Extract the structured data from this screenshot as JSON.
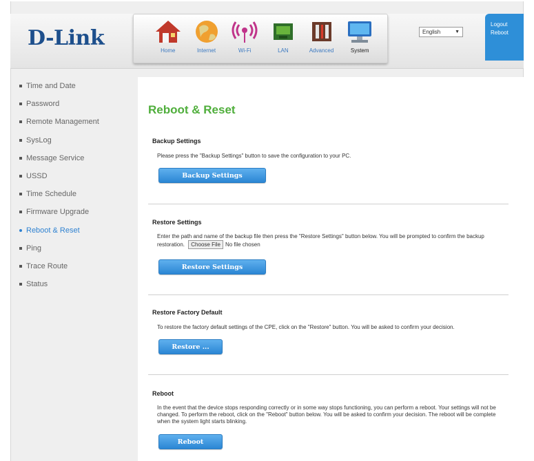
{
  "brand": {
    "logo": "D-Link"
  },
  "toolbar": {
    "items": [
      {
        "label": "Home",
        "icon": "home-icon"
      },
      {
        "label": "Internet",
        "icon": "globe-icon"
      },
      {
        "label": "Wi-Fi",
        "icon": "wifi-icon"
      },
      {
        "label": "LAN",
        "icon": "lan-icon"
      },
      {
        "label": "Advanced",
        "icon": "tools-icon"
      },
      {
        "label": "System",
        "icon": "computer-icon"
      }
    ],
    "active": "System"
  },
  "language": {
    "selected": "English"
  },
  "account": {
    "logout": "Logout",
    "reboot": "Reboot"
  },
  "sidebar": {
    "items": [
      {
        "label": "Time and Date"
      },
      {
        "label": "Password"
      },
      {
        "label": "Remote Management"
      },
      {
        "label": "SysLog"
      },
      {
        "label": "Message Service"
      },
      {
        "label": "USSD"
      },
      {
        "label": "Time Schedule"
      },
      {
        "label": "Firmware Upgrade"
      },
      {
        "label": "Reboot & Reset"
      },
      {
        "label": "Ping"
      },
      {
        "label": "Trace Route"
      },
      {
        "label": "Status"
      }
    ],
    "active_index": 8
  },
  "main": {
    "title": "Reboot & Reset",
    "backup": {
      "heading": "Backup Settings",
      "text": "Please press the \"Backup Settings\" button to save the configuration to your PC.",
      "button": "Backup Settings"
    },
    "restore": {
      "heading": "Restore Settings",
      "text": "Enter the path and name of the backup file then press the \"Restore Settings\" button below. You will be prompted to confirm the backup restoration.",
      "choose_file": "Choose File",
      "no_file": "No file chosen",
      "button": "Restore Settings"
    },
    "factory": {
      "heading": "Restore Factory Default",
      "text": "To restore the factory default settings of the CPE, click on the \"Restore\" button. You will be asked to confirm your decision.",
      "button": "Restore ..."
    },
    "reboot": {
      "heading": "Reboot",
      "text": "In the event that the device stops responding correctly or in some way stops functioning, you can perform a reboot. Your settings will not be changed. To perform the reboot, click on the \"Reboot\" button below. You will be asked to confirm your decision. The reboot will be complete when the system light starts blinking.",
      "button": "Reboot"
    }
  },
  "colors": {
    "accent_blue": "#2e8fd8",
    "title_green": "#4fae3b",
    "logo_blue": "#1d4f8c"
  }
}
